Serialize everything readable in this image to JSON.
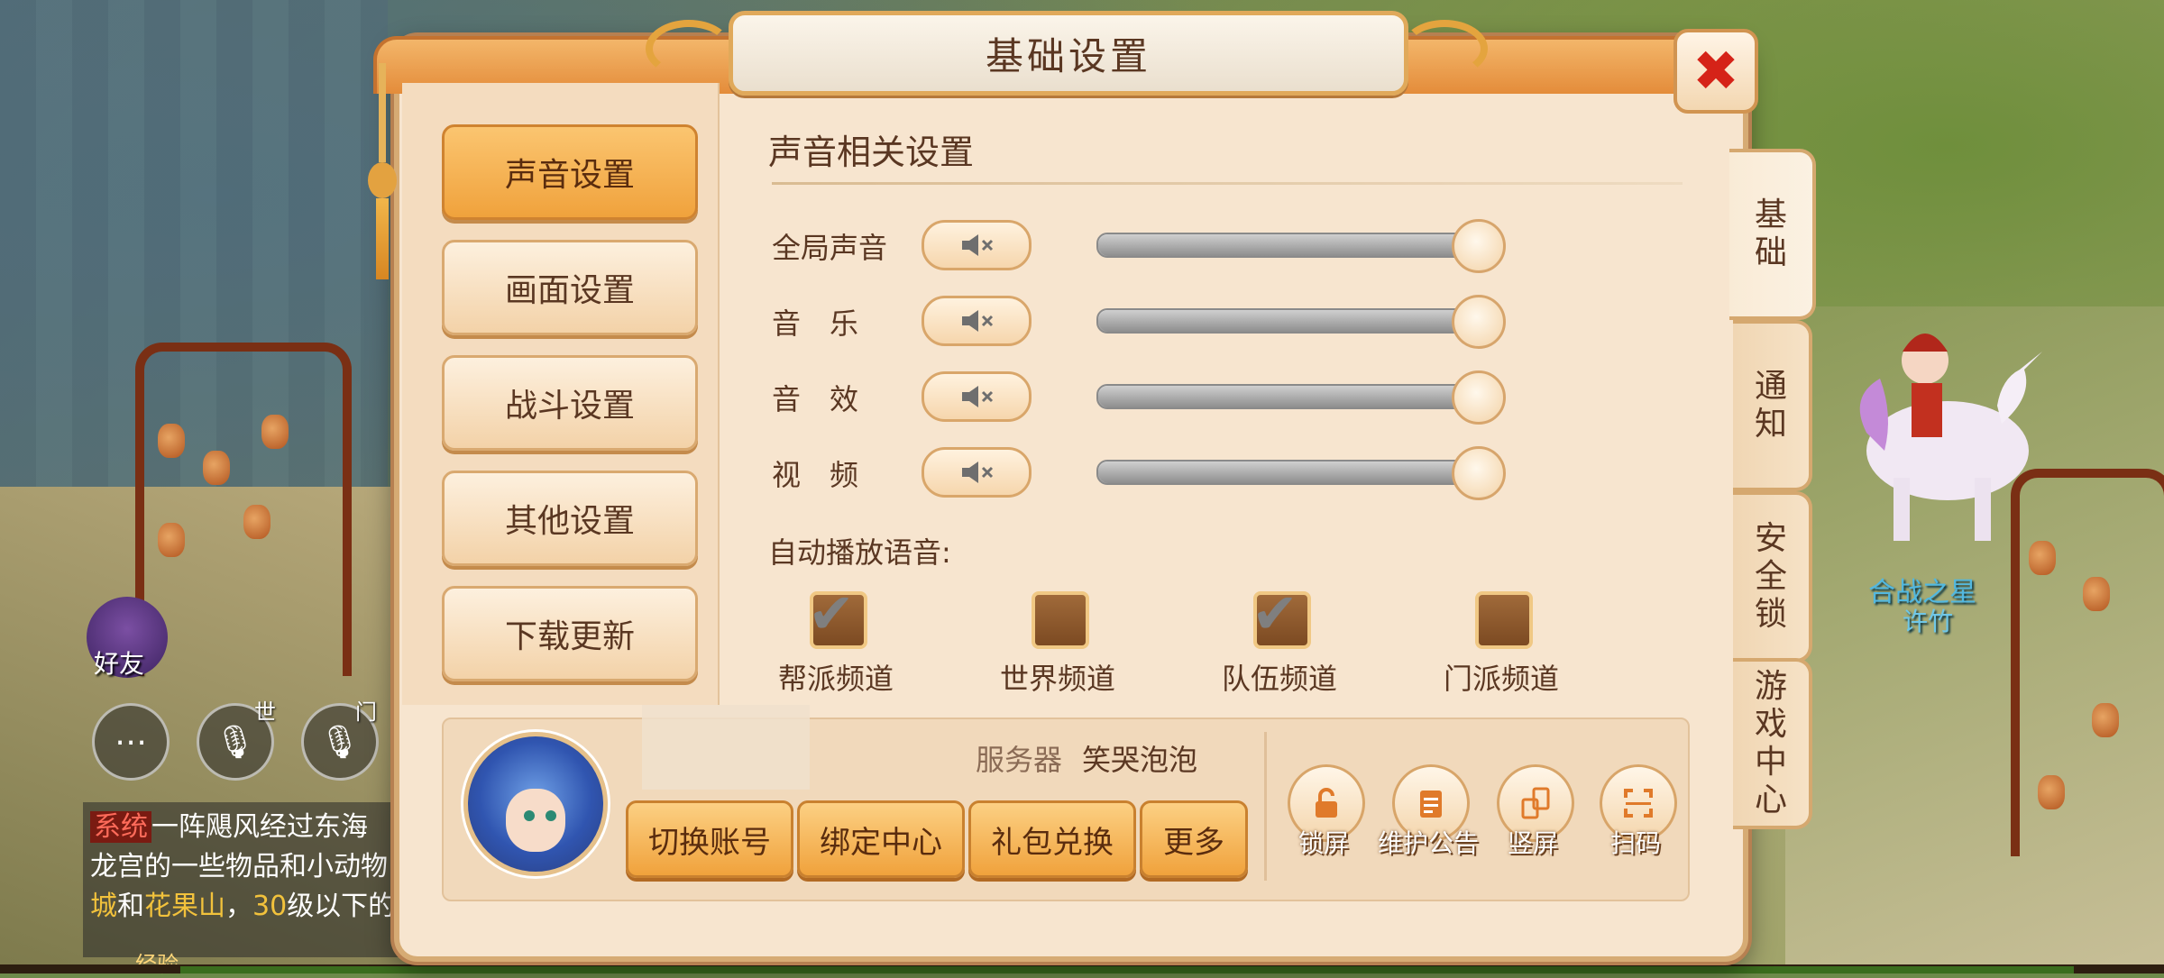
{
  "dialog": {
    "title": "基础设置",
    "close_glyph": "✖"
  },
  "nav": {
    "items": [
      {
        "label": "声音设置",
        "active": true
      },
      {
        "label": "画面设置",
        "active": false
      },
      {
        "label": "战斗设置",
        "active": false
      },
      {
        "label": "其他设置",
        "active": false
      },
      {
        "label": "下载更新",
        "active": false
      }
    ]
  },
  "sound": {
    "section_title": "声音相关设置",
    "rows": [
      {
        "label": "全局声音",
        "volume": 1.0
      },
      {
        "label": "音　乐",
        "volume": 1.0
      },
      {
        "label": "音　效",
        "volume": 1.0
      },
      {
        "label": "视　频",
        "volume": 1.0
      }
    ],
    "auto_play_label": "自动播放语音:",
    "channels": [
      {
        "label": "帮派频道",
        "checked": true
      },
      {
        "label": "世界频道",
        "checked": false
      },
      {
        "label": "队伍频道",
        "checked": true
      },
      {
        "label": "门派频道",
        "checked": false
      }
    ]
  },
  "account": {
    "server_label": "服务器",
    "server_name": "笑哭泡泡",
    "buttons": [
      "切换账号",
      "绑定中心",
      "礼包兑换",
      "更多"
    ],
    "tools": [
      {
        "label": "锁屏",
        "icon": "lock-icon"
      },
      {
        "label": "维护公告",
        "icon": "notice-board-icon"
      },
      {
        "label": "竖屏",
        "icon": "rotate-screen-icon"
      },
      {
        "label": "扫码",
        "icon": "scan-icon"
      }
    ]
  },
  "side_tabs": [
    {
      "label": "基础",
      "active": true
    },
    {
      "label": "通知",
      "active": false
    },
    {
      "label": "安全锁",
      "active": false
    },
    {
      "label": "游戏中心",
      "active": false
    }
  ],
  "hud": {
    "friend_label": "好友",
    "world_label": "世",
    "sect_label": "门",
    "chat_tag": "系统",
    "chat_line1": "一阵飓风经过东海",
    "chat_line2": "龙宫的一些物品和小动物",
    "chat_line3_a": "城",
    "chat_line3_b": "和",
    "chat_line3_c": "花果山",
    "chat_line3_d": "，",
    "chat_line3_e": "30",
    "chat_line3_f": "级以下的",
    "exp_label": "经验",
    "npc_title": "合战之星",
    "npc_name": "许竹"
  },
  "colors": {
    "accent": "#f0a23c",
    "panel": "#f7e5cf",
    "text": "#5a3722",
    "close": "#d52318"
  }
}
